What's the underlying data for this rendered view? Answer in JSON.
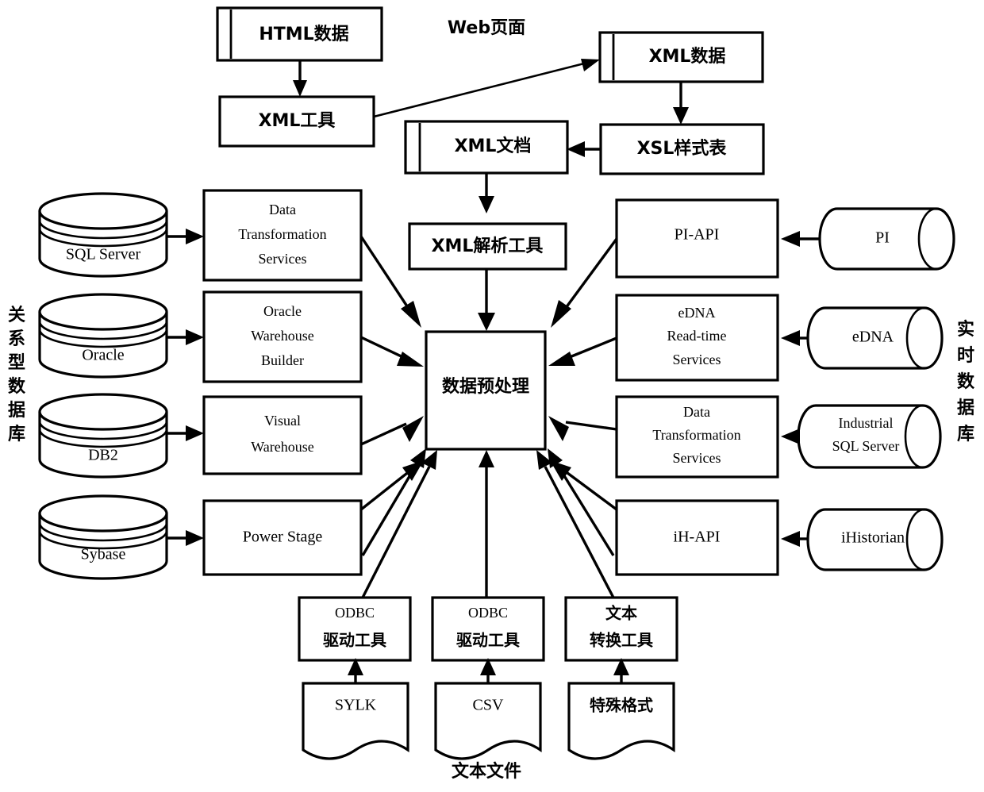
{
  "diagram": {
    "title_label_web": "Web页面",
    "title_label_textfiles": "文本文件",
    "side_label_left": "关系型数据库",
    "side_label_right": "实时数据库",
    "center_node": "数据预处理",
    "web_flow": {
      "html_data": "HTML数据",
      "xml_tool": "XML工具",
      "xml_data": "XML数据",
      "xsl_stylesheet": "XSL样式表",
      "xml_document": "XML文档",
      "xml_parser_tool": "XML解析工具"
    },
    "relational": {
      "sources": [
        "SQL Server",
        "Oracle",
        "DB2",
        "Sybase"
      ],
      "tools": [
        {
          "lines": [
            "Data",
            "Transformation",
            "Services"
          ]
        },
        {
          "lines": [
            "Oracle",
            "Warehouse",
            "Builder"
          ]
        },
        {
          "lines": [
            "Visual",
            "Warehouse"
          ]
        },
        {
          "lines": [
            "Power Stage"
          ]
        }
      ]
    },
    "realtime": {
      "sources": [
        "PI",
        "eDNA",
        "Industrial SQL Server",
        "iHistorian"
      ],
      "source_lines": [
        [
          "PI"
        ],
        [
          "eDNA"
        ],
        [
          "Industrial",
          "SQL Server"
        ],
        [
          "iHistorian"
        ]
      ],
      "tools": [
        {
          "lines": [
            "PI-API"
          ]
        },
        {
          "lines": [
            "eDNA",
            "Read-time",
            "Services"
          ]
        },
        {
          "lines": [
            "Data",
            "Transformation",
            "Services"
          ]
        },
        {
          "lines": [
            "iH-API"
          ]
        }
      ]
    },
    "textfiles": {
      "files": [
        "SYLK",
        "CSV",
        "特殊格式"
      ],
      "tools": [
        {
          "lines": [
            "ODBC",
            "驱动工具"
          ]
        },
        {
          "lines": [
            "ODBC",
            "驱动工具"
          ]
        },
        {
          "lines": [
            "文本",
            "转换工具"
          ]
        }
      ]
    },
    "colors": {
      "stroke": "#000000",
      "fill": "#ffffff"
    }
  }
}
